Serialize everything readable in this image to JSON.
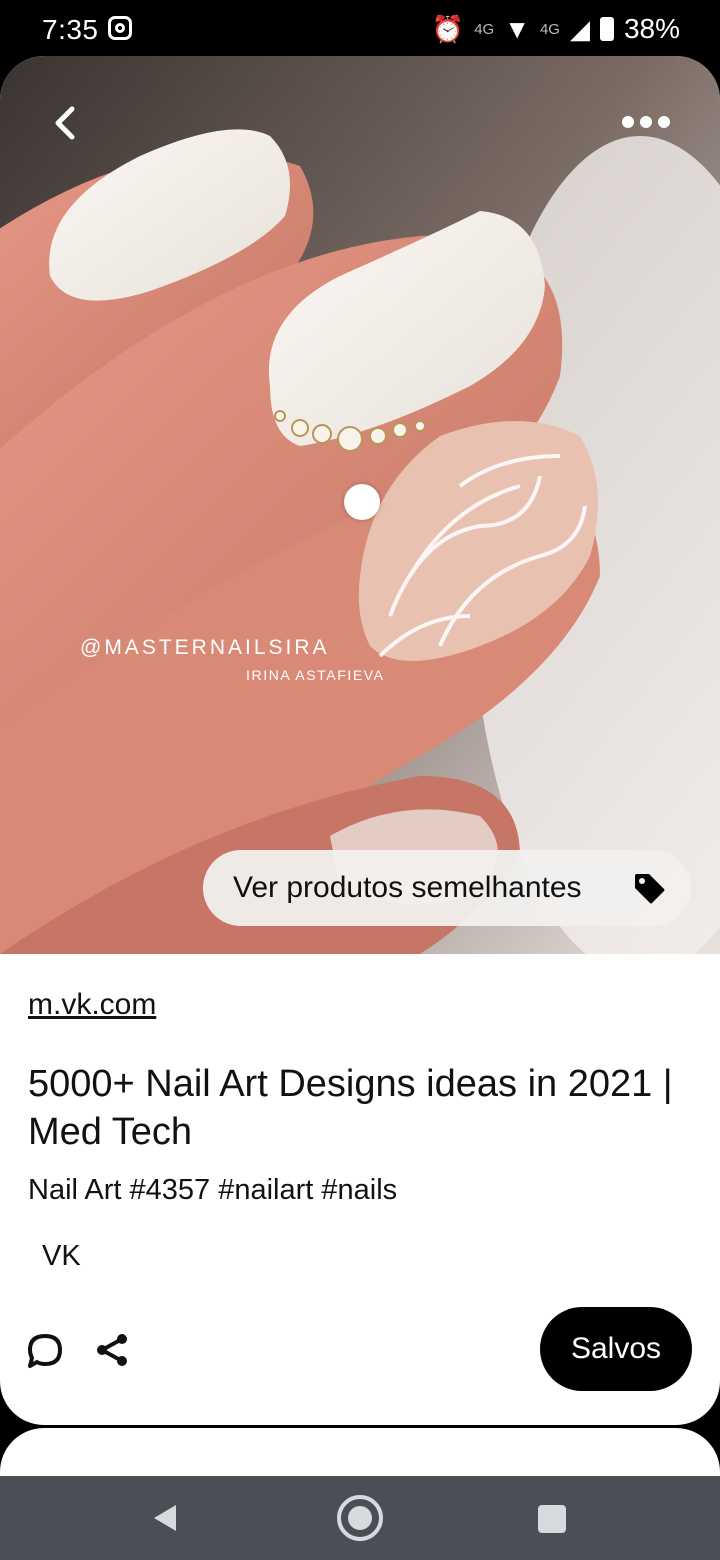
{
  "status_bar": {
    "time": "7:35",
    "network_label_1": "4G",
    "network_label_2": "4G",
    "battery": "38%"
  },
  "pin": {
    "watermark_handle": "@MASTERNAILSIRA",
    "watermark_name": "IRINA ASTAFIEVA",
    "similar_products_label": "Ver produtos semelhantes",
    "source_link": "m.vk.com",
    "title": "5000+ Nail Art Designs ideas in 2021 | Med Tech",
    "description": "Nail Art #4357 #nailart #nails",
    "author": "VK",
    "save_label": "Salvos"
  },
  "icons": {
    "back": "chevron-left-icon",
    "more": "more-horizontal-icon",
    "tag": "tag-icon",
    "comment": "comment-icon",
    "share": "share-icon"
  },
  "colors": {
    "save_button": "#000000",
    "nav_bar": "#4a4f55"
  }
}
